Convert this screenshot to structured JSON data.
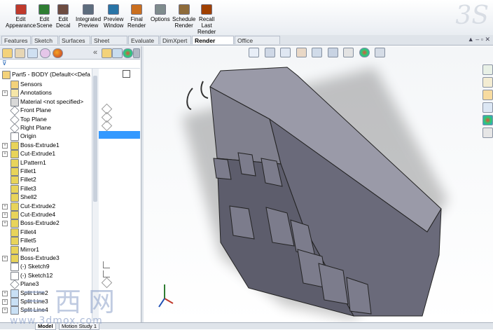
{
  "ribbon": {
    "buttons": [
      {
        "label": "Edit\nAppearance",
        "icon": "sphere-paint-icon",
        "color": "#c0392b"
      },
      {
        "label": "Edit\nScene",
        "icon": "scene-icon",
        "color": "#2e7d32"
      },
      {
        "label": "Edit\nDecal",
        "icon": "decal-icon",
        "color": "#6d4c41"
      },
      {
        "label": "Integrated\nPreview",
        "icon": "integrated-preview-icon",
        "color": "#5d6d7e"
      },
      {
        "label": "Preview\nWindow",
        "icon": "preview-window-icon",
        "color": "#2874a6"
      },
      {
        "label": "Final\nRender",
        "icon": "final-render-icon",
        "color": "#ca6f1e"
      },
      {
        "label": "Options",
        "icon": "options-icon",
        "color": "#7f8c8d"
      },
      {
        "label": "Schedule\nRender",
        "icon": "schedule-render-icon",
        "color": "#8e6b3a"
      },
      {
        "label": "Recall\nLast\nRender",
        "icon": "recall-render-icon",
        "color": "#a04000"
      }
    ],
    "logo": "3S"
  },
  "tabs": [
    "Features",
    "Sketch",
    "Surfaces",
    "Sheet Metal",
    "Evaluate",
    "DimXpert",
    "Render Tools",
    "Office Products"
  ],
  "active_tab": "Render Tools",
  "tree": {
    "root": "Part5  - BODY (Default<<Defa",
    "items": [
      {
        "label": "Sensors",
        "icon": "sensors-icon",
        "exp": ""
      },
      {
        "label": "Annotations",
        "icon": "annotations-icon",
        "exp": "+"
      },
      {
        "label": "Material <not specified>",
        "icon": "material-icon",
        "exp": ""
      },
      {
        "label": "Front Plane",
        "icon": "plane-icon",
        "exp": ""
      },
      {
        "label": "Top Plane",
        "icon": "plane-icon",
        "exp": ""
      },
      {
        "label": "Right Plane",
        "icon": "plane-icon",
        "exp": ""
      },
      {
        "label": "Origin",
        "icon": "origin-icon",
        "exp": ""
      },
      {
        "label": "Boss-Extrude1",
        "icon": "boss-extrude-icon",
        "exp": "+"
      },
      {
        "label": "Cut-Extrude1",
        "icon": "cut-extrude-icon",
        "exp": "+"
      },
      {
        "label": "LPattern1",
        "icon": "pattern-icon",
        "exp": ""
      },
      {
        "label": "Fillet1",
        "icon": "fillet-icon",
        "exp": ""
      },
      {
        "label": "Fillet2",
        "icon": "fillet-icon",
        "exp": ""
      },
      {
        "label": "Fillet3",
        "icon": "fillet-icon",
        "exp": ""
      },
      {
        "label": "Shell2",
        "icon": "shell-icon",
        "exp": ""
      },
      {
        "label": "Cut-Extrude2",
        "icon": "cut-extrude-icon",
        "exp": "+"
      },
      {
        "label": "Cut-Extrude4",
        "icon": "cut-extrude-icon",
        "exp": "+"
      },
      {
        "label": "Boss-Extrude2",
        "icon": "boss-extrude-icon",
        "exp": "+"
      },
      {
        "label": "Fillet4",
        "icon": "fillet-icon",
        "exp": ""
      },
      {
        "label": "Fillet5",
        "icon": "fillet-icon",
        "exp": ""
      },
      {
        "label": "Mirror1",
        "icon": "mirror-icon",
        "exp": ""
      },
      {
        "label": "Boss-Extrude3",
        "icon": "boss-extrude-icon",
        "exp": "+"
      },
      {
        "label": "(-) Sketch9",
        "icon": "sketch-icon",
        "exp": ""
      },
      {
        "label": "(-) Sketch12",
        "icon": "sketch-icon",
        "exp": ""
      },
      {
        "label": "Plane3",
        "icon": "plane-icon",
        "exp": ""
      },
      {
        "label": "Split Line2",
        "icon": "split-line-icon",
        "exp": "+"
      },
      {
        "label": "Split Line3",
        "icon": "split-line-icon",
        "exp": "+"
      },
      {
        "label": "Split Line4",
        "icon": "split-line-icon",
        "exp": "+"
      }
    ]
  },
  "bottom_tabs": [
    "Model",
    "Motion Study 1"
  ],
  "active_bottom_tab": "Model",
  "watermark": {
    "cn": "三西网",
    "url": "www.3dmox.com"
  },
  "colors": {
    "part": "#6e6e7e",
    "part_light": "#9c9caa",
    "selection": "#3399ff",
    "viewport_bg": "#ffffff"
  }
}
